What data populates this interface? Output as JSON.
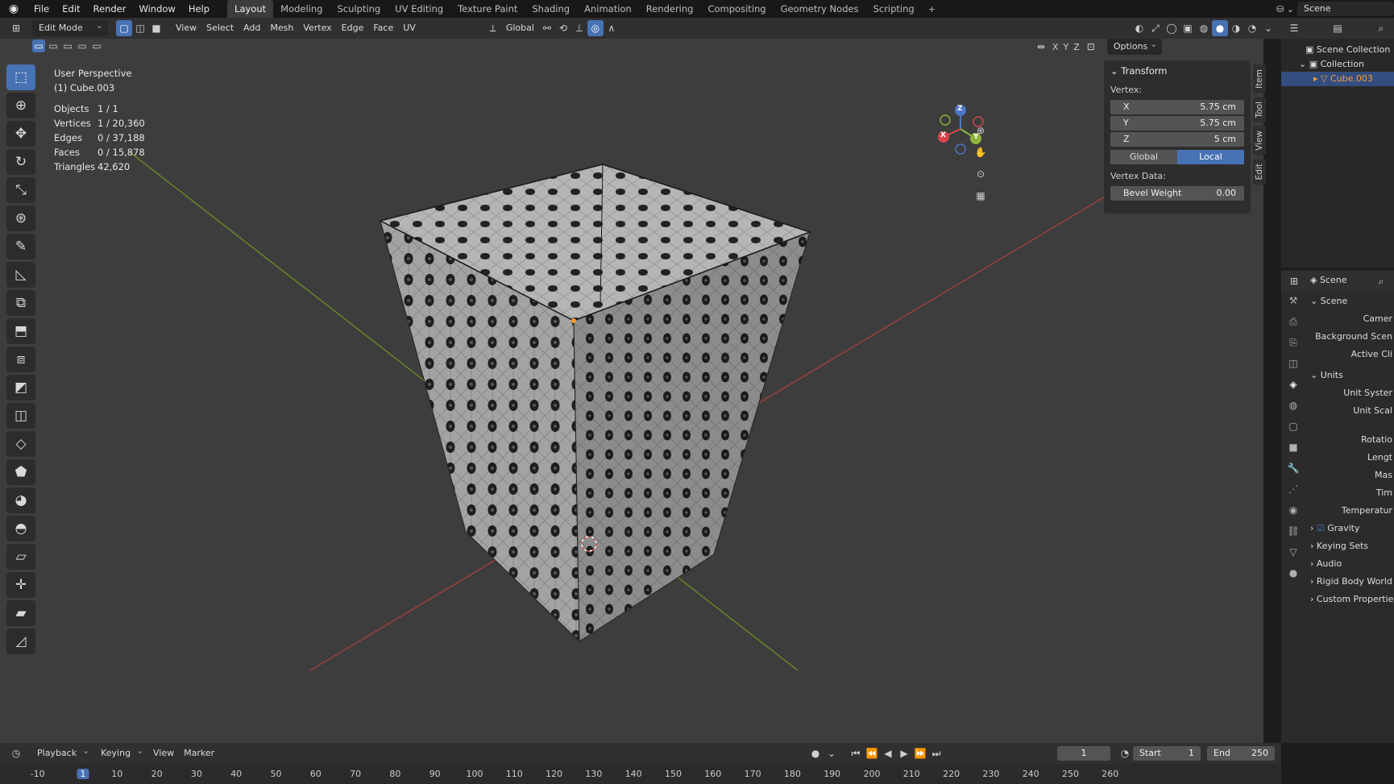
{
  "topbar": {
    "menus": [
      "File",
      "Edit",
      "Render",
      "Window",
      "Help"
    ],
    "workspaces": [
      "Layout",
      "Modeling",
      "Sculpting",
      "UV Editing",
      "Texture Paint",
      "Shading",
      "Animation",
      "Rendering",
      "Compositing",
      "Geometry Nodes",
      "Scripting"
    ],
    "active_workspace": "Layout",
    "scene_name": "Scene"
  },
  "viewport_header": {
    "mode": "Edit Mode",
    "menus": [
      "View",
      "Select",
      "Add",
      "Mesh",
      "Vertex",
      "Edge",
      "Face",
      "UV"
    ],
    "orientation": "Global",
    "options_label": "Options",
    "axes": [
      "X",
      "Y",
      "Z"
    ]
  },
  "overlay": {
    "view_name": "User Perspective",
    "object_name": "(1) Cube.003"
  },
  "stats": [
    {
      "key": "Objects",
      "value": "1 / 1"
    },
    {
      "key": "Vertices",
      "value": "1 / 20,360"
    },
    {
      "key": "Edges",
      "value": "0 / 37,188"
    },
    {
      "key": "Faces",
      "value": "0 / 15,878"
    },
    {
      "key": "Triangles",
      "value": "42,620"
    }
  ],
  "transform_panel": {
    "title": "Transform",
    "vertex_label": "Vertex:",
    "x": {
      "label": "X",
      "value": "5.75 cm"
    },
    "y": {
      "label": "Y",
      "value": "5.75 cm"
    },
    "z": {
      "label": "Z",
      "value": "5 cm"
    },
    "global_label": "Global",
    "local_label": "Local",
    "vertex_data_label": "Vertex Data:",
    "bevel": {
      "label": "Bevel Weight",
      "value": "0.00"
    }
  },
  "side_tabs": [
    "Item",
    "Tool",
    "View",
    "Edit"
  ],
  "gizmo": {
    "x": "X",
    "y": "Y",
    "z": "Z"
  },
  "outliner": {
    "scene_collection": "Scene Collection",
    "collection": "Collection",
    "object": "Cube.003"
  },
  "properties": {
    "header": "Scene",
    "rows": [
      "Scene",
      "Camer",
      "Background Scen",
      "Active Cli",
      "Units",
      "Unit Syster",
      "Unit Scal",
      "Rotatio",
      "Lengt",
      "Mas",
      "Tim",
      "Temperatur"
    ],
    "gravity": "Gravity",
    "sections": [
      "Keying Sets",
      "Audio",
      "Rigid Body World",
      "Custom Properties"
    ]
  },
  "timeline": {
    "menus": [
      "Playback",
      "Keying",
      "View",
      "Marker"
    ],
    "current_frame": "1",
    "start_label": "Start",
    "start_value": "1",
    "end_label": "End",
    "end_value": "250",
    "ticks": [
      "-10",
      "1",
      "10",
      "20",
      "30",
      "40",
      "50",
      "60",
      "70",
      "80",
      "90",
      "100",
      "110",
      "120",
      "130",
      "140",
      "150",
      "160",
      "170",
      "180",
      "190",
      "200",
      "210",
      "220",
      "230",
      "240",
      "250",
      "260"
    ]
  },
  "colors": {
    "accent": "#4772b3",
    "x_axis": "#b03a3a",
    "y_axis": "#6c8f24",
    "mesh": "#9d9d9d"
  }
}
